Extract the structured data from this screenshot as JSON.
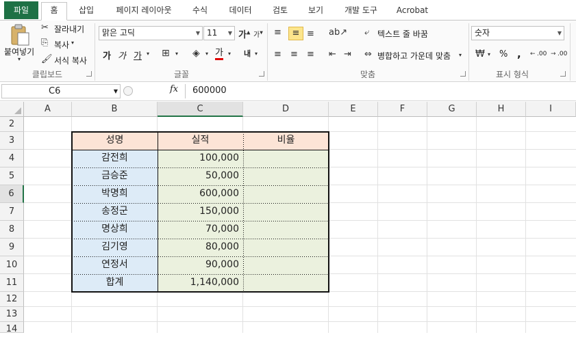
{
  "tabs": [
    {
      "id": "file",
      "label": "파일"
    },
    {
      "id": "home",
      "label": "홈"
    },
    {
      "id": "insert",
      "label": "삽입"
    },
    {
      "id": "page_layout",
      "label": "페이지 레이아웃"
    },
    {
      "id": "formulas",
      "label": "수식"
    },
    {
      "id": "data",
      "label": "데이터"
    },
    {
      "id": "review",
      "label": "검토"
    },
    {
      "id": "view",
      "label": "보기"
    },
    {
      "id": "developer",
      "label": "개발 도구"
    },
    {
      "id": "acrobat",
      "label": "Acrobat"
    }
  ],
  "ribbon": {
    "clipboard": {
      "paste": "붙여넣기",
      "cut": "잘라내기",
      "copy": "복사",
      "format_painter": "서식 복사",
      "group_label": "클립보드"
    },
    "font": {
      "font_name": "맑은 고딕",
      "font_size": "11",
      "bold": "가",
      "italic": "가",
      "underline": "가",
      "font_color_glyph": "가",
      "phonetic_glyph": "내",
      "group_label": "글꼴"
    },
    "alignment": {
      "wrap_text": "텍스트 줄 바꿈",
      "merge_center": "병합하고 가운데 맞춤",
      "group_label": "맞춤"
    },
    "number": {
      "format": "숫자",
      "percent": "%",
      "comma": ",",
      "increase_decimal": ".00",
      "decrease_decimal": ".00",
      "group_label": "표시 형식"
    }
  },
  "formula_bar": {
    "name_box": "C6",
    "fx_label": "fx",
    "value": "600000"
  },
  "columns": [
    "A",
    "B",
    "C",
    "D",
    "E",
    "F",
    "G",
    "H",
    "I"
  ],
  "rows": [
    "2",
    "3",
    "4",
    "5",
    "6",
    "7",
    "8",
    "9",
    "10",
    "11",
    "12",
    "13",
    "14"
  ],
  "table": {
    "headers": [
      "성명",
      "실적",
      "비율"
    ],
    "records": [
      {
        "name": "감전희",
        "amount": "100,000",
        "rate": ""
      },
      {
        "name": "금승준",
        "amount": "50,000",
        "rate": ""
      },
      {
        "name": "박명희",
        "amount": "600,000",
        "rate": ""
      },
      {
        "name": "송정군",
        "amount": "150,000",
        "rate": ""
      },
      {
        "name": "명상희",
        "amount": "70,000",
        "rate": ""
      },
      {
        "name": "김기영",
        "amount": "80,000",
        "rate": ""
      },
      {
        "name": "연정서",
        "amount": "90,000",
        "rate": ""
      },
      {
        "name": "합계",
        "amount": "1,140,000",
        "rate": ""
      }
    ]
  },
  "selected_cell": "C6",
  "colors": {
    "accent": "#217346",
    "file_tab": "#1e7145",
    "header_fill": "#fce4d6",
    "name_fill": "#ddebf7",
    "value_fill": "#ebf1de"
  }
}
